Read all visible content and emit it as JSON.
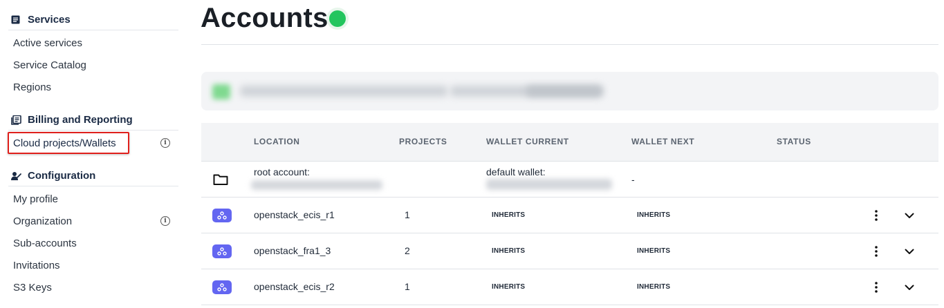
{
  "sidebar": {
    "sections": [
      {
        "title": "Services",
        "icon": "services-icon",
        "items": [
          "Active services",
          "Service Catalog",
          "Regions"
        ]
      },
      {
        "title": "Billing and Reporting",
        "icon": "billing-icon",
        "items": [
          "Cloud projects/Wallets"
        ]
      },
      {
        "title": "Configuration",
        "icon": "configuration-icon",
        "items": [
          "My profile",
          "Organization",
          "Sub-accounts",
          "Invitations",
          "S3 Keys"
        ]
      }
    ],
    "info_glyph": "i",
    "selected_item": "Cloud projects/Wallets"
  },
  "page": {
    "title": "Accounts",
    "status_color": "#23c55e"
  },
  "table": {
    "headers": {
      "location": "LOCATION",
      "projects": "PROJECTS",
      "wallet_current": "WALLET CURRENT",
      "wallet_next": "WALLET NEXT",
      "status": "STATUS"
    },
    "root_row": {
      "location_label": "root account:",
      "wallet_label": "default wallet:",
      "wallet_next": "-"
    },
    "rows": [
      {
        "location": "openstack_ecis_r1",
        "projects": "1",
        "wallet_current": "INHERITS",
        "wallet_next": "INHERITS"
      },
      {
        "location": "openstack_fra1_3",
        "projects": "2",
        "wallet_current": "INHERITS",
        "wallet_next": "INHERITS"
      },
      {
        "location": "openstack_ecis_r2",
        "projects": "1",
        "wallet_current": "INHERITS",
        "wallet_next": "INHERITS"
      }
    ]
  },
  "colors": {
    "accent_indigo": "#6366f1",
    "highlight_red": "#e0201c",
    "status_green": "#23c55e"
  }
}
